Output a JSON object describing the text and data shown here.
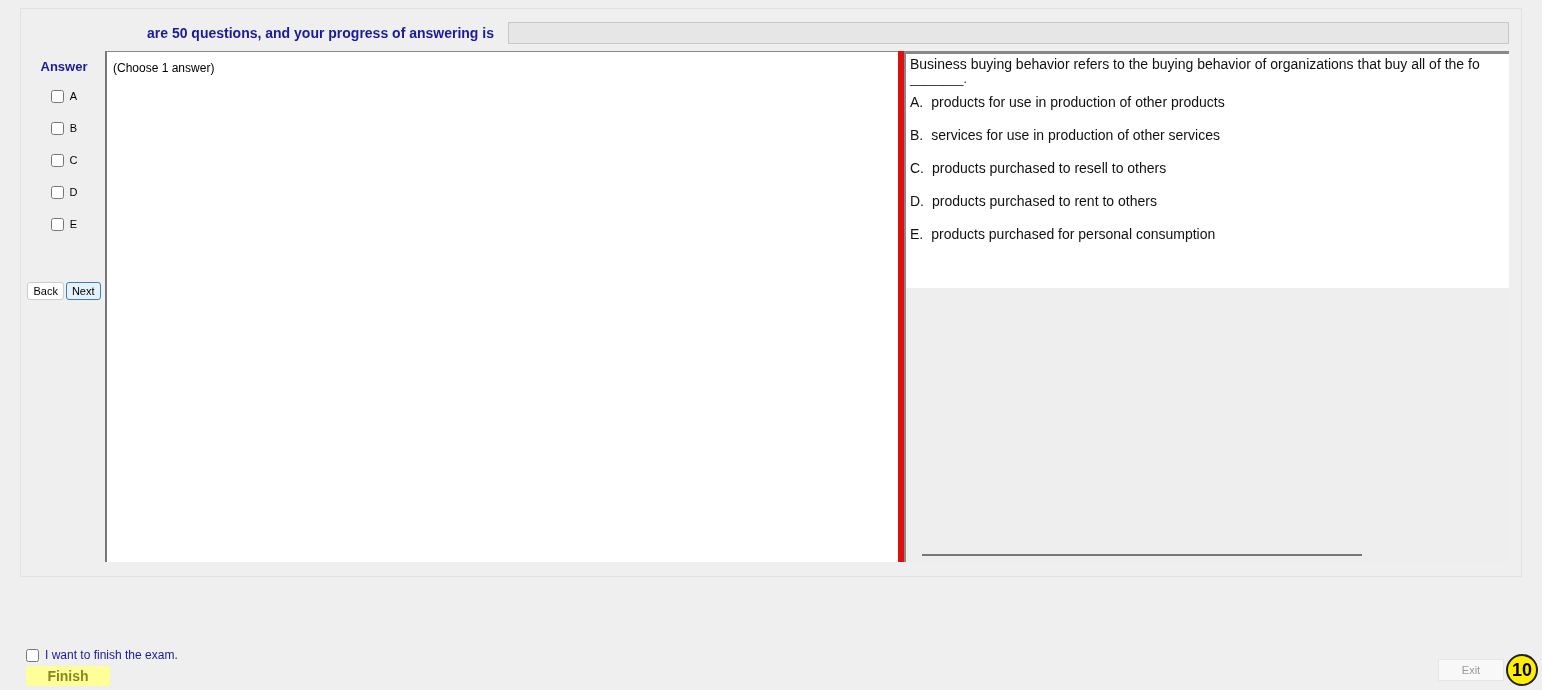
{
  "header": {
    "text": "are 50 questions, and your progress of answering is",
    "progress": {
      "level": 0
    }
  },
  "answer_panel": {
    "title": "Answer",
    "options": [
      {
        "label": "A",
        "checked": false
      },
      {
        "label": "B",
        "checked": false
      },
      {
        "label": "C",
        "checked": false
      },
      {
        "label": "D",
        "checked": false
      },
      {
        "label": "E",
        "checked": false
      }
    ],
    "buttons": [
      {
        "label": "Back",
        "selected": false
      },
      {
        "label": "Next",
        "selected": true
      }
    ]
  },
  "answer_area": {
    "hint": "(Choose 1 answer)"
  },
  "question": {
    "text": "Business buying behavior refers to the buying behavior of organizations that buy all of the fo",
    "blank": "________.",
    "choices": [
      {
        "letter": "A.",
        "text": "products for use in production of other products"
      },
      {
        "letter": "B.",
        "text": "services for use in production of other services"
      },
      {
        "letter": "C.",
        "text": "products purchased to resell to others"
      },
      {
        "letter": "D.",
        "text": "products purchased to rent to others"
      },
      {
        "letter": "E.",
        "text": "products purchased for personal consumption"
      }
    ]
  },
  "footer": {
    "confirm": {
      "label": "I want to finish the exam.",
      "checked": false
    },
    "finish": "Finish",
    "exit": {
      "label": "Exit",
      "disabled": true
    },
    "badge": "10"
  }
}
